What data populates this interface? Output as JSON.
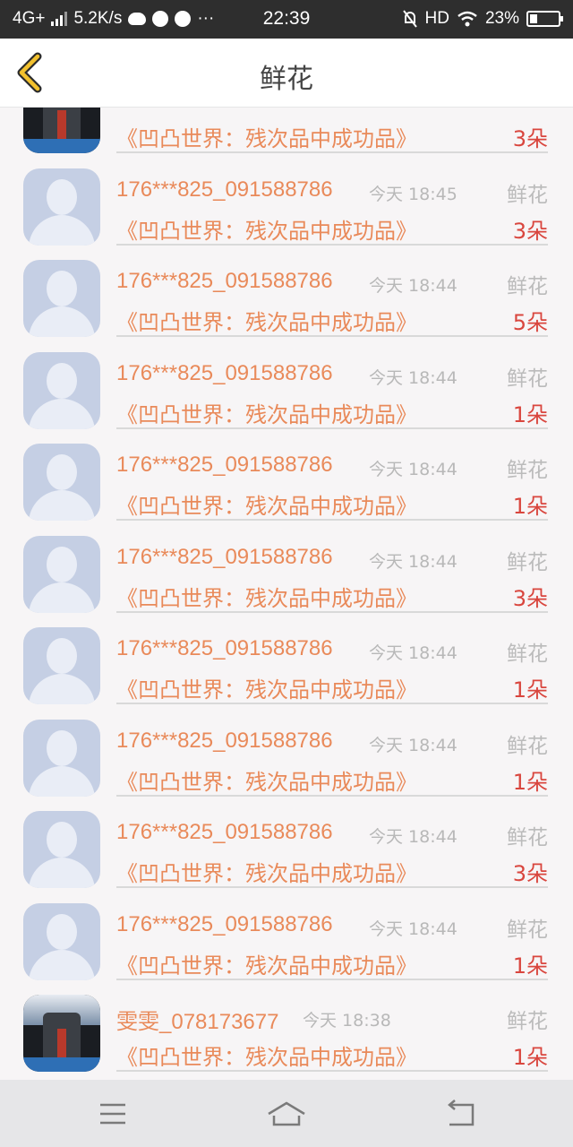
{
  "status_bar": {
    "network": "4G+",
    "speed": "5.2K/s",
    "time": "22:39",
    "hd": "HD",
    "battery": "23%"
  },
  "header": {
    "title": "鲜花",
    "back_icon": "chevron-left-icon"
  },
  "items": [
    {
      "name": "",
      "time": "",
      "type": "",
      "work": "《凹凸世界：残次品中成功品》",
      "count": "3朵",
      "avatar": "robot-photo"
    },
    {
      "name": "176***825_091588786",
      "time": "今天 18:45",
      "type": "鲜花",
      "work": "《凹凸世界：残次品中成功品》",
      "count": "3朵",
      "avatar": "default"
    },
    {
      "name": "176***825_091588786",
      "time": "今天 18:44",
      "type": "鲜花",
      "work": "《凹凸世界：残次品中成功品》",
      "count": "5朵",
      "avatar": "default"
    },
    {
      "name": "176***825_091588786",
      "time": "今天 18:44",
      "type": "鲜花",
      "work": "《凹凸世界：残次品中成功品》",
      "count": "1朵",
      "avatar": "default"
    },
    {
      "name": "176***825_091588786",
      "time": "今天 18:44",
      "type": "鲜花",
      "work": "《凹凸世界：残次品中成功品》",
      "count": "1朵",
      "avatar": "default"
    },
    {
      "name": "176***825_091588786",
      "time": "今天 18:44",
      "type": "鲜花",
      "work": "《凹凸世界：残次品中成功品》",
      "count": "3朵",
      "avatar": "default"
    },
    {
      "name": "176***825_091588786",
      "time": "今天 18:44",
      "type": "鲜花",
      "work": "《凹凸世界：残次品中成功品》",
      "count": "1朵",
      "avatar": "default"
    },
    {
      "name": "176***825_091588786",
      "time": "今天 18:44",
      "type": "鲜花",
      "work": "《凹凸世界：残次品中成功品》",
      "count": "1朵",
      "avatar": "default"
    },
    {
      "name": "176***825_091588786",
      "time": "今天 18:44",
      "type": "鲜花",
      "work": "《凹凸世界：残次品中成功品》",
      "count": "3朵",
      "avatar": "default"
    },
    {
      "name": "176***825_091588786",
      "time": "今天 18:44",
      "type": "鲜花",
      "work": "《凹凸世界：残次品中成功品》",
      "count": "1朵",
      "avatar": "default"
    },
    {
      "name": "雯雯_078173677",
      "time": "今天 18:38",
      "type": "鲜花",
      "work": "《凹凸世界：残次品中成功品》",
      "count": "1朵",
      "avatar": "robot-photo"
    }
  ],
  "navbar": {
    "menu_icon": "menu-icon",
    "home_icon": "home-icon",
    "back_icon": "return-icon"
  },
  "colors": {
    "accent": "#e98a5a",
    "count": "#d9463e",
    "muted": "#bbbbbb"
  }
}
